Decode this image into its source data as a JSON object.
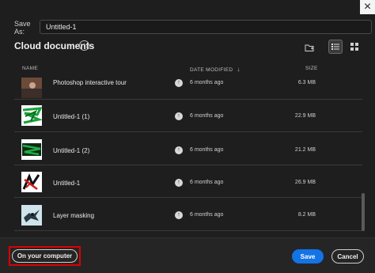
{
  "dialog": {
    "close_glyph": "×"
  },
  "save_as": {
    "label": "Save As:",
    "value": "Untitled-1"
  },
  "header": {
    "title": "Cloud documents",
    "info_glyph": "i"
  },
  "columns": {
    "name": "NAME",
    "date": "DATE MODIFIED",
    "sort_glyph": "↓",
    "size": "SIZE"
  },
  "files": [
    {
      "name": "Photoshop interactive tour",
      "date": "6 months ago",
      "size": "6.3 MB",
      "thumb": "photo"
    },
    {
      "name": "Untitled-1 (1)",
      "date": "6 months ago",
      "size": "22.9 MB",
      "thumb": "green-scribble"
    },
    {
      "name": "Untitled-1 (2)",
      "date": "6 months ago",
      "size": "21.2 MB",
      "thumb": "green-dark"
    },
    {
      "name": "Untitled-1",
      "date": "6 months ago",
      "size": "26.9 MB",
      "thumb": "red-black"
    },
    {
      "name": "Layer masking",
      "date": "6 months ago",
      "size": "8.2 MB",
      "thumb": "bird"
    }
  ],
  "cloud_glyph": "↑",
  "footer": {
    "on_computer": "On your computer",
    "save": "Save",
    "cancel": "Cancel"
  },
  "colors": {
    "accent": "#1473e6",
    "highlight": "#dd0000",
    "background": "#1e1e1e"
  }
}
